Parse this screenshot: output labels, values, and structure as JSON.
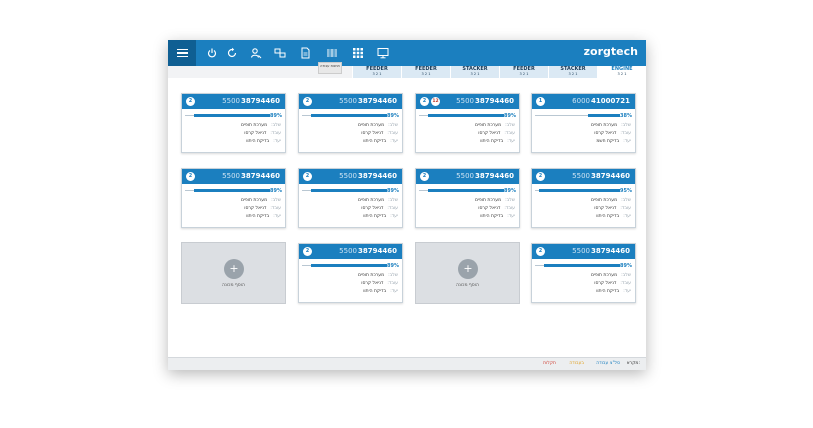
{
  "app": {
    "brand": "zorgtech",
    "tooltip": "תחנות עבודה"
  },
  "colors": {
    "primary": "#1b7fbf",
    "dark": "#0f5f93"
  },
  "toolbar_icons": [
    "power-icon",
    "refresh-icon",
    "user-search-icon",
    "transfer-icon",
    "document-icon",
    "barcode-list-icon",
    "grid-icon",
    "monitor-icon"
  ],
  "tabs": [
    {
      "title": "FEEDER",
      "sub": "3 2 1"
    },
    {
      "title": "FEEDER",
      "sub": "3 2 1"
    },
    {
      "title": "STACKER",
      "sub": "3 2 1"
    },
    {
      "title": "FEEDER",
      "sub": "3 2 1"
    },
    {
      "title": "STACKER",
      "sub": "3 2 1"
    },
    {
      "title": "ENGINE",
      "sub": "3 2 1"
    }
  ],
  "cards": [
    {
      "badge": "1",
      "order": "41000721",
      "qty": "6000",
      "progress": 0.38,
      "pct": "38%",
      "rows": [
        {
          "label": "שלב:",
          "value": "מערכת תופים"
        },
        {
          "label": "עובד:",
          "value": "דניאל קרסו"
        },
        {
          "label": "יעד:",
          "value": "בדיקת חשמ"
        }
      ]
    },
    {
      "badge": "2",
      "badge2": "12",
      "order": "38794460",
      "qty": "5500",
      "progress": 0.89,
      "pct": "89%",
      "rows": [
        {
          "label": "שלב:",
          "value": "מערכת תופים"
        },
        {
          "label": "עובד:",
          "value": "דניאל קרסו"
        },
        {
          "label": "יעד:",
          "value": "בדיקת היתוו"
        }
      ]
    },
    {
      "badge": "2",
      "order": "38794460",
      "qty": "5500",
      "progress": 0.89,
      "pct": "89%",
      "rows": [
        {
          "label": "שלב:",
          "value": "מערכת תופים"
        },
        {
          "label": "עובד:",
          "value": "דניאל קרסו"
        },
        {
          "label": "יעד:",
          "value": "בדיקת היתוו"
        }
      ]
    },
    {
      "badge": "2",
      "order": "38794460",
      "qty": "5500",
      "progress": 0.89,
      "pct": "89%",
      "rows": [
        {
          "label": "שלב:",
          "value": "מערכת תופים"
        },
        {
          "label": "עובד:",
          "value": "דניאל קרסו"
        },
        {
          "label": "יעד:",
          "value": "בדיקת היתוו"
        }
      ]
    },
    {
      "badge": "2",
      "order": "38794460",
      "qty": "5500",
      "progress": 0.95,
      "pct": "95%",
      "rows": [
        {
          "label": "שלב:",
          "value": "מערכת תופים"
        },
        {
          "label": "עובד:",
          "value": "דניאל קרסו"
        },
        {
          "label": "יעד:",
          "value": "בדיקת היתוו"
        }
      ]
    },
    {
      "badge": "2",
      "order": "38794460",
      "qty": "5500",
      "progress": 0.89,
      "pct": "89%",
      "rows": [
        {
          "label": "שלב:",
          "value": "מערכת תופים"
        },
        {
          "label": "עובד:",
          "value": "דניאל קרסו"
        },
        {
          "label": "יעד:",
          "value": "בדיקת היתוו"
        }
      ]
    },
    {
      "badge": "2",
      "order": "38794460",
      "qty": "5500",
      "progress": 0.89,
      "pct": "89%",
      "rows": [
        {
          "label": "שלב:",
          "value": "מערכת תופים"
        },
        {
          "label": "עובד:",
          "value": "דניאל קרסו"
        },
        {
          "label": "יעד:",
          "value": "בדיקת היתוו"
        }
      ]
    },
    {
      "badge": "2",
      "order": "38794460",
      "qty": "5500",
      "progress": 0.89,
      "pct": "89%",
      "rows": [
        {
          "label": "שלב:",
          "value": "מערכת תופים"
        },
        {
          "label": "עובד:",
          "value": "דניאל קרסו"
        },
        {
          "label": "יעד:",
          "value": "בדיקת היתוו"
        }
      ]
    },
    {
      "badge": "2",
      "order": "38794460",
      "qty": "5500",
      "progress": 0.89,
      "pct": "89%",
      "rows": [
        {
          "label": "שלב:",
          "value": "מערכת תופים"
        },
        {
          "label": "עובד:",
          "value": "דניאל קרסו"
        },
        {
          "label": "יעד:",
          "value": "בדיקת היתוו"
        }
      ]
    },
    {
      "badge": "2",
      "order": "38794460",
      "qty": "5500",
      "progress": 0.89,
      "pct": "89%",
      "rows": [
        {
          "label": "שלב:",
          "value": "מערכת תופים"
        },
        {
          "label": "עובד:",
          "value": "דניאל קרסו"
        },
        {
          "label": "יעד:",
          "value": "בדיקת היתוו"
        }
      ]
    }
  ],
  "add_machine": {
    "label": "הוסף מכונה",
    "icon": "+"
  },
  "footer": {
    "legend": "מקרא:",
    "items": [
      {
        "label": "סל\"צ עבודה",
        "color": "#1b7fbf"
      },
      {
        "label": "בעבודה",
        "color": "#e0a020"
      },
      {
        "label": "תקלות",
        "color": "#d0463a"
      }
    ]
  }
}
